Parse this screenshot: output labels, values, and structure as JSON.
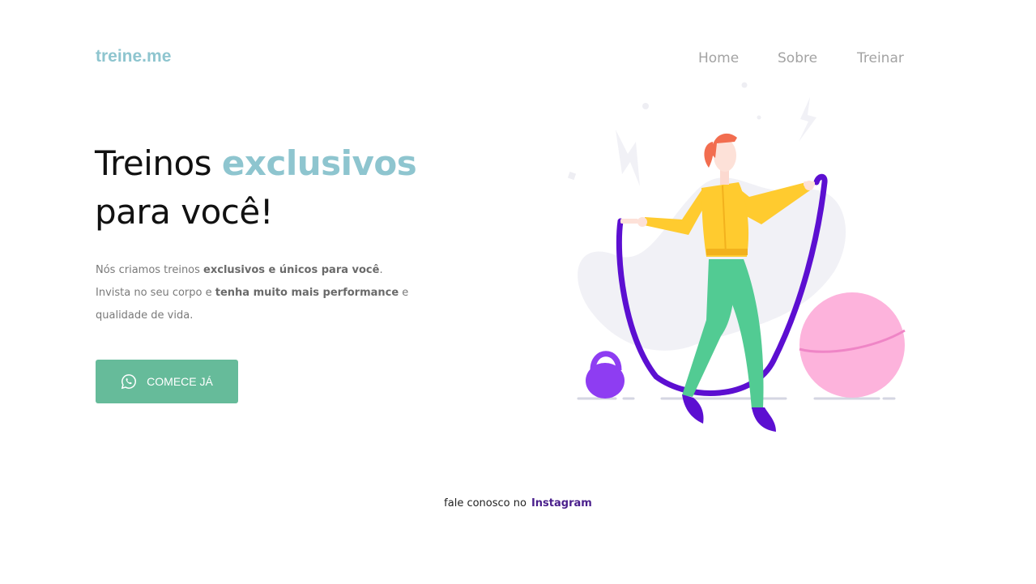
{
  "brand": {
    "logo": "treine.me"
  },
  "nav": {
    "home": "Home",
    "sobre": "Sobre",
    "treinar": "Treinar"
  },
  "hero": {
    "title_1": "Treinos ",
    "title_accent": "exclusivos",
    "title_2": "para você!",
    "desc_1": "Nós criamos treinos ",
    "desc_1_bold": "exclusivos e únicos para você",
    "desc_1_end": ".",
    "desc_2": "Invista no seu corpo e ",
    "desc_2_bold": "tenha muito mais performance",
    "desc_2_end": " e",
    "desc_3": "qualidade de vida.",
    "cta": {
      "label": "COMECE JÁ",
      "icon": "whatsapp-icon"
    }
  },
  "illustration": {
    "subject": "woman-jump-rope-illustration"
  },
  "footer": {
    "text": "fale conosco no",
    "link": "Instagram"
  },
  "colors": {
    "accent": "#8ec5cf",
    "cta": "#66bb9a",
    "link": "#4a1f8c",
    "rope": "#5c0fd1"
  }
}
